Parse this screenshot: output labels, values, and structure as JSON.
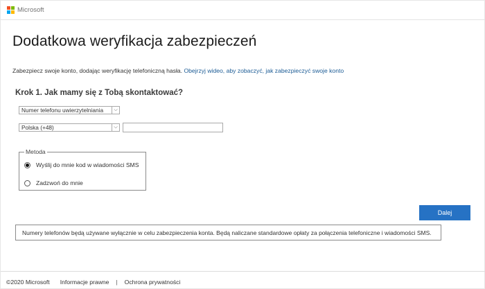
{
  "header": {
    "brand": "Microsoft",
    "logo_colors": [
      "#f25022",
      "#7fba00",
      "#00a4ef",
      "#ffb900"
    ]
  },
  "page": {
    "title": "Dodatkowa weryfikacja zabezpieczeń",
    "intro_text": "Zabezpiecz swoje konto, dodając weryfikację telefoniczną hasła.",
    "intro_link": "Obejrzyj wideo, aby zobaczyć, jak zabezpieczyć swoje konto"
  },
  "step1": {
    "heading": "Krok 1. Jak mamy się z Tobą skontaktować?",
    "contact_type_selected": "Numer telefonu uwierzytelniania",
    "country_selected": "Polska (+48)",
    "phone_value": "",
    "method": {
      "legend": "Metoda",
      "options": [
        {
          "label": "Wyślij do mnie kod w wiadomości SMS",
          "checked": true
        },
        {
          "label": "Zadzwoń do mnie",
          "checked": false
        }
      ]
    }
  },
  "actions": {
    "next_label": "Dalej",
    "accent_color": "#2672c4"
  },
  "notice": "Numery telefonów będą używane wyłącznie w celu zabezpieczenia konta. Będą naliczane standardowe opłaty za połączenia telefoniczne i wiadomości SMS.",
  "footer": {
    "copyright": "©2020 Microsoft",
    "legal_link": "Informacje prawne",
    "separator": "|",
    "privacy_link": "Ochrona prywatności"
  }
}
